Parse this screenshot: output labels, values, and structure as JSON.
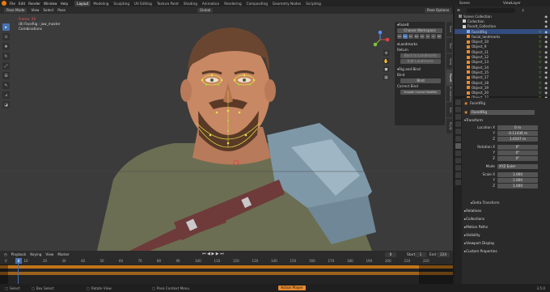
{
  "menu": {
    "items": [
      "File",
      "Edit",
      "Render",
      "Window",
      "Help"
    ],
    "workspaces": [
      "Layout",
      "Modeling",
      "Sculpting",
      "UV Editing",
      "Texture Paint",
      "Shading",
      "Animation",
      "Rendering",
      "Compositing",
      "Geometry Nodes",
      "Scripting"
    ],
    "active_workspace": "Layout",
    "scene_label": "Scene",
    "view_layer_label": "ViewLayer"
  },
  "viewport_header": {
    "mode": "Pose Mode",
    "menus": [
      "View",
      "Select",
      "Pose"
    ],
    "orientation": "Global",
    "pose_options": "Pose Options"
  },
  "overlay": {
    "line1": "Frame: 20",
    "line2": "(8) FaceRig : jaw_master",
    "line3": "Combinations"
  },
  "npanel": {
    "title": "FaceIt",
    "workspace_btn": "Choose Workspace",
    "tabs": [
      "Se",
      "Rig",
      "Ex",
      "Ba",
      "Sh",
      "Ar",
      "Cr",
      "RE"
    ],
    "landmarks": "Landmarks",
    "return_label": "Return",
    "back_landmarks": "Back to Landmarks",
    "edit_landmarks": "Edit Landmarks",
    "rig_bind": "Rig and Bind",
    "bind_label": "Bind",
    "bind_btn": "Bind",
    "correct_bind": "Correct Bind",
    "smooth_btn": "Smooth Correct Modifier"
  },
  "vtabs": [
    "Item",
    "Tool",
    "View",
    "FaceIt",
    "Animation",
    "Edit",
    "Rigify"
  ],
  "timeline": {
    "menus": [
      "Playback",
      "Keying",
      "View",
      "Marker"
    ],
    "current_frame": "8",
    "start_label": "Start",
    "start_value": "1",
    "end_label": "End",
    "end_value": "224",
    "ticks": [
      "0",
      "10",
      "20",
      "30",
      "40",
      "50",
      "60",
      "70",
      "80",
      "90",
      "100",
      "110",
      "120",
      "130",
      "140",
      "150",
      "160",
      "170",
      "180",
      "190",
      "200",
      "210",
      "220"
    ]
  },
  "status": {
    "select": "Select",
    "box_select": "Box Select",
    "rotate_view": "Rotate View",
    "context_menu": "Pose Context Menu",
    "mode_btn": "Action Player",
    "version": "3.5.0"
  },
  "outliner": {
    "rows": [
      {
        "name": "Scene Collection",
        "depth": 0,
        "sel": false
      },
      {
        "name": "Collection",
        "depth": 1,
        "sel": false
      },
      {
        "name": "FaceIt_Collection",
        "depth": 1,
        "sel": false
      },
      {
        "name": "FaceitRig",
        "depth": 2,
        "sel": true
      },
      {
        "name": "facial_landmarks",
        "depth": 2,
        "sel": false
      },
      {
        "name": "Object_10",
        "depth": 2,
        "sel": false
      },
      {
        "name": "Object_9",
        "depth": 2,
        "sel": false
      },
      {
        "name": "Object_11",
        "depth": 2,
        "sel": false
      },
      {
        "name": "Object_12",
        "depth": 2,
        "sel": false
      },
      {
        "name": "Object_13",
        "depth": 2,
        "sel": false
      },
      {
        "name": "Object_14",
        "depth": 2,
        "sel": false
      },
      {
        "name": "Object_15",
        "depth": 2,
        "sel": false
      },
      {
        "name": "Object_17",
        "depth": 2,
        "sel": false
      },
      {
        "name": "Object_18",
        "depth": 2,
        "sel": false
      },
      {
        "name": "Object_19",
        "depth": 2,
        "sel": false
      },
      {
        "name": "Object_20",
        "depth": 2,
        "sel": false
      },
      {
        "name": "Object_22",
        "depth": 2,
        "sel": false
      }
    ]
  },
  "properties": {
    "object_name": "FaceitRig",
    "object_field": "FaceitRig",
    "transform": "Transform",
    "location_label": "Location X",
    "loc_x": "0 m",
    "loc_y": "-0.11436 m",
    "loc_z": "1.6107 m",
    "rotation_label": "Rotation X",
    "rot_x": "0°",
    "rot_y": "0°",
    "rot_z": "0°",
    "mode_label": "Mode",
    "mode_value": "XYZ Euler",
    "scale_label": "Scale X",
    "scale_x": "1.000",
    "scale_y": "1.000",
    "scale_z": "1.000",
    "delta": "Delta Transform",
    "sections": [
      "Relations",
      "Collections",
      "Motion Paths",
      "Visibility",
      "Viewport Display",
      "Custom Properties"
    ],
    "y_label": "Y",
    "z_label": "Z"
  },
  "colors": {
    "accent": "#4772b3",
    "keyframe": "#d17e1a",
    "rig_green": "#9bd23c",
    "rig_yellow": "#e6e04a",
    "object_orange": "#e98a2d"
  }
}
